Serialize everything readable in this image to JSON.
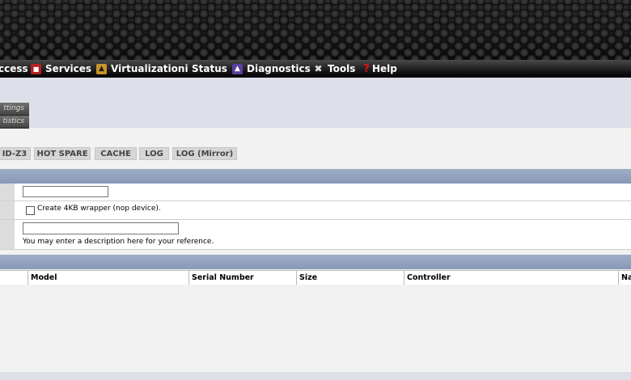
{
  "menu": {
    "items": [
      {
        "label": "ccess",
        "icon": "access-icon"
      },
      {
        "label": "Services",
        "icon": "services-icon"
      },
      {
        "label": "Virtualization",
        "icon": "virtualization-icon"
      },
      {
        "label": "Status",
        "icon": "status-icon"
      },
      {
        "label": "Diagnostics",
        "icon": "diagnostics-icon"
      },
      {
        "label": "Tools",
        "icon": "tools-icon"
      },
      {
        "label": "Help",
        "icon": "help-icon"
      }
    ]
  },
  "subtabs": [
    "ttings",
    "tistics"
  ],
  "vdev_tabs": [
    "ID-Z3",
    "HOT SPARE",
    "CACHE",
    "LOG",
    "LOG (Mirror)"
  ],
  "form": {
    "name_value": "",
    "wrapper_label": "Create 4KB wrapper (nop device).",
    "wrapper_checked": false,
    "description_value": "",
    "description_hint": "You may enter a description here for your reference."
  },
  "table": {
    "columns": [
      "",
      "Model",
      "Serial Number",
      "Size",
      "Controller",
      "Na"
    ]
  },
  "colors": {
    "section_bar": "#9faec7",
    "menubar": "#1a1a1a",
    "help_icon": "#cc0000",
    "diagnostics_icon": "#5a3fa0"
  }
}
